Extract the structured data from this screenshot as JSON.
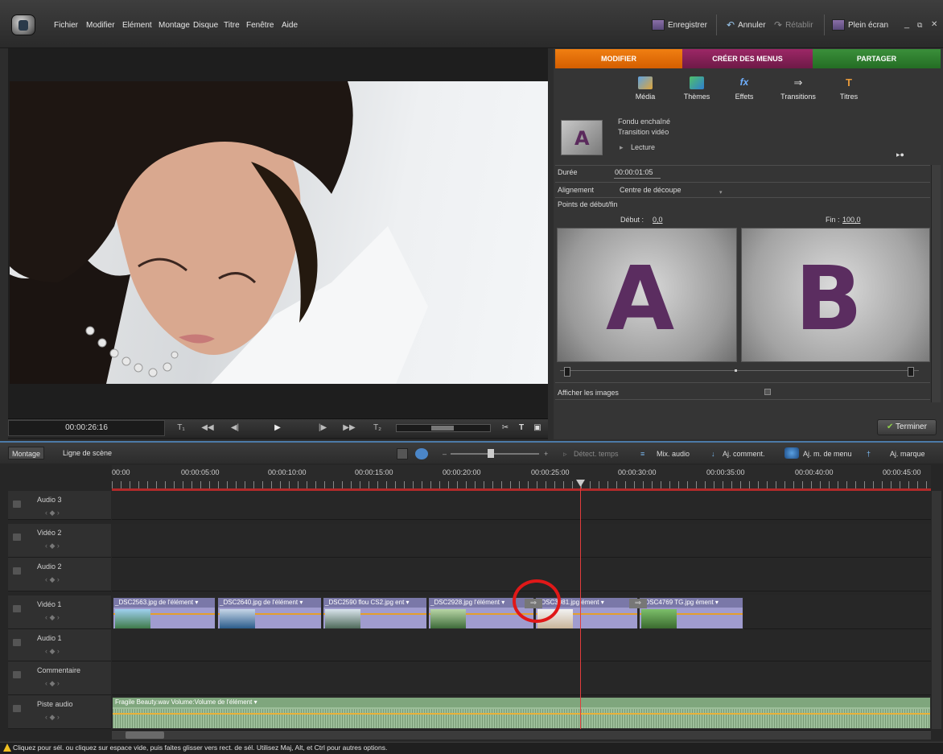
{
  "menu": [
    "Fichier",
    "Modifier",
    "Elément",
    "Montage",
    "Disque",
    "Titre",
    "Fenêtre",
    "Aide"
  ],
  "top_buttons": {
    "save": "Enregistrer",
    "undo": "Annuler",
    "redo": "Rétablir",
    "fullscreen": "Plein écran"
  },
  "monitor": {
    "timecode": "00:00:26:16"
  },
  "tabs": {
    "modify": "MODIFIER",
    "menus": "CRÉER DES MENUS",
    "share": "PARTAGER"
  },
  "tools": [
    "Média",
    "Thèmes",
    "Effets",
    "Transitions",
    "Titres"
  ],
  "transition": {
    "name": "Fondu enchaîné",
    "type": "Transition vidéo",
    "play": "Lecture",
    "thumb_letter": "A"
  },
  "props": {
    "duration_label": "Durée",
    "duration_value": "00:00:01:05",
    "alignment_label": "Alignement",
    "alignment_value": "Centre de découpe",
    "points_label": "Points de début/fin",
    "start_label": "Début :",
    "start_value": "0,0",
    "end_label": "Fin :",
    "end_value": "100,0",
    "show_images": "Afficher les images",
    "letter_a": "A",
    "letter_b": "B"
  },
  "finish_button": "Terminer",
  "timeline": {
    "tab_montage": "Montage",
    "tab_scene": "Ligne de scène",
    "detect_tempo": "Détect. temps",
    "audio_mix": "Mix. audio",
    "add_comment": "Aj. comment.",
    "add_menu": "Aj. m. de menu",
    "add_marker": "Aj. marque",
    "ruler": [
      "00:00",
      "00:00:05:00",
      "00:00:10:00",
      "00:00:15:00",
      "00:00:20:00",
      "00:00:25:00",
      "00:00:30:00",
      "00:00:35:00",
      "00:00:40:00",
      "00:00:45:00"
    ],
    "tracks": [
      "Audio 3",
      "Vidéo 2",
      "Audio 2",
      "Vidéo 1",
      "Audio 1",
      "Commentaire",
      "Piste audio"
    ],
    "clips": [
      "_DSC2563.jpg  de l'élément ▾",
      "_DSC2640.jpg  de l'élément ▾",
      "_DSC2590 flou CS2.jpg  ent ▾",
      "_DSC2928.jpg  l'élément ▾",
      "_DSC3081.jpg  ément ▾",
      "_DSC4769 TG.jpg  ément ▾"
    ],
    "audio_clip": "Fragile Beauty.wav  Volume:Volume de l'élément ▾"
  },
  "status": "Cliquez pour sél. ou cliquez sur espace vide, puis faites glisser vers rect. de sél. Utilisez Maj, Alt, et Ctrl pour autres options.",
  "colors": {
    "accent_orange": "#e06a05",
    "accent_magenta": "#8a2159",
    "accent_green": "#2f7f2f",
    "playhead": "#e23c3c"
  }
}
